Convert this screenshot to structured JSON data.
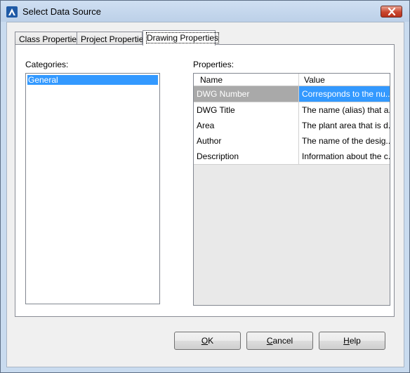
{
  "window": {
    "title": "Select Data Source"
  },
  "tabs": [
    {
      "label": "Class Properties"
    },
    {
      "label": "Project Properties"
    },
    {
      "label": "Drawing Properties",
      "active": true
    }
  ],
  "categories": {
    "label": "Categories:",
    "items": [
      "General"
    ],
    "selected": "General"
  },
  "properties": {
    "label": "Properties:",
    "columns": [
      "Name",
      "Value"
    ],
    "rows": [
      {
        "name": "DWG Number",
        "value": "Corresponds to the nu..."
      },
      {
        "name": "DWG Title",
        "value": "The name (alias) that a..."
      },
      {
        "name": "Area",
        "value": "The plant area that is d..."
      },
      {
        "name": "Author",
        "value": "The name of the desig..."
      },
      {
        "name": "Description",
        "value": "Information about the c..."
      }
    ],
    "selected_row": 0
  },
  "buttons": {
    "ok": {
      "mnemonic": "O",
      "rest": "K"
    },
    "cancel": {
      "mnemonic": "C",
      "rest": "ancel"
    },
    "help": {
      "mnemonic": "H",
      "rest": "elp"
    }
  },
  "colors": {
    "selection": "#3399ff",
    "selection_inactive": "#a9a9a9",
    "window_frame": "#c9dbef"
  }
}
